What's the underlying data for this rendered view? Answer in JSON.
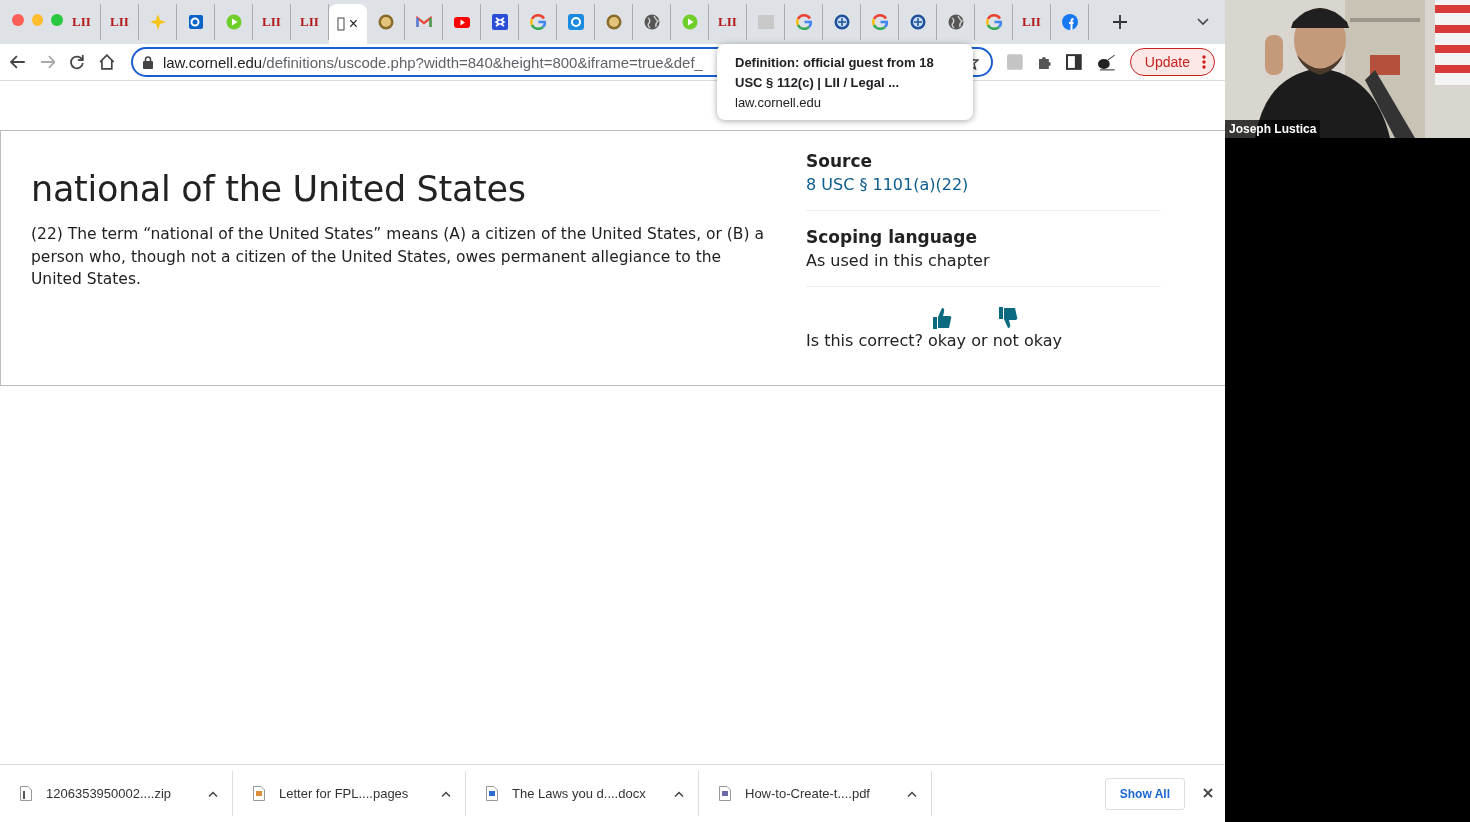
{
  "tabs": [
    {
      "kind": "lii",
      "label": "LII",
      "selected": false
    },
    {
      "kind": "lii",
      "label": "LII",
      "selected": false
    },
    {
      "kind": "star",
      "selected": false
    },
    {
      "kind": "outlook",
      "selected": false
    },
    {
      "kind": "rumble",
      "selected": false
    },
    {
      "kind": "lii",
      "label": "LII",
      "selected": false
    },
    {
      "kind": "lii",
      "label": "LII",
      "selected": false
    },
    {
      "kind": "blank-page",
      "close": "×",
      "selected": true
    },
    {
      "kind": "seal",
      "selected": false
    },
    {
      "kind": "gmail",
      "selected": false
    },
    {
      "kind": "youtube",
      "selected": false
    },
    {
      "kind": "dropbox",
      "selected": false
    },
    {
      "kind": "google",
      "selected": false
    },
    {
      "kind": "s-app",
      "selected": false
    },
    {
      "kind": "seal",
      "selected": false
    },
    {
      "kind": "globe",
      "selected": false
    },
    {
      "kind": "rumble",
      "selected": false
    },
    {
      "kind": "lii",
      "label": "LII",
      "selected": false
    },
    {
      "kind": "grey-square",
      "selected": false
    },
    {
      "kind": "google",
      "selected": false
    },
    {
      "kind": "agency",
      "selected": false
    },
    {
      "kind": "google",
      "selected": false
    },
    {
      "kind": "agency",
      "selected": false
    },
    {
      "kind": "globe",
      "selected": false
    },
    {
      "kind": "google",
      "selected": false
    },
    {
      "kind": "lii",
      "label": "LII",
      "selected": false
    },
    {
      "kind": "facebook",
      "selected": false
    }
  ],
  "address": {
    "host": "law.cornell.edu",
    "path": "/definitions/uscode.php?width=840&height=800&iframe=true&def_"
  },
  "update_button": "Update",
  "tooltip": {
    "title": "Definition: official guest from 18 USC § 112(c) | LII / Legal ...",
    "host": "law.cornell.edu"
  },
  "definition": {
    "term": "national of the United States",
    "text": "(22) The term “national of the United States” means (A) a citizen of the United States, or (B) a person who, though not a citizen of the United States, owes permanent allegiance to the United States."
  },
  "sidebar": {
    "source_heading": "Source",
    "source_link": "8 USC § 1101(a)(22)",
    "scope_heading": "Scoping language",
    "scope_text": "As used in this chapter"
  },
  "feedback": {
    "question": "Is this correct?",
    "yes": "okay",
    "or": "or",
    "no": "not okay"
  },
  "downloads": [
    {
      "kind": "zip",
      "name": "1206353950002....zip"
    },
    {
      "kind": "pages",
      "name": "Letter for FPL....pages"
    },
    {
      "kind": "docx",
      "name": "The Laws you d....docx"
    },
    {
      "kind": "pdf",
      "name": "How-to-Create-t....pdf"
    }
  ],
  "show_all": "Show All",
  "video": {
    "name": "Joseph Lustica"
  }
}
